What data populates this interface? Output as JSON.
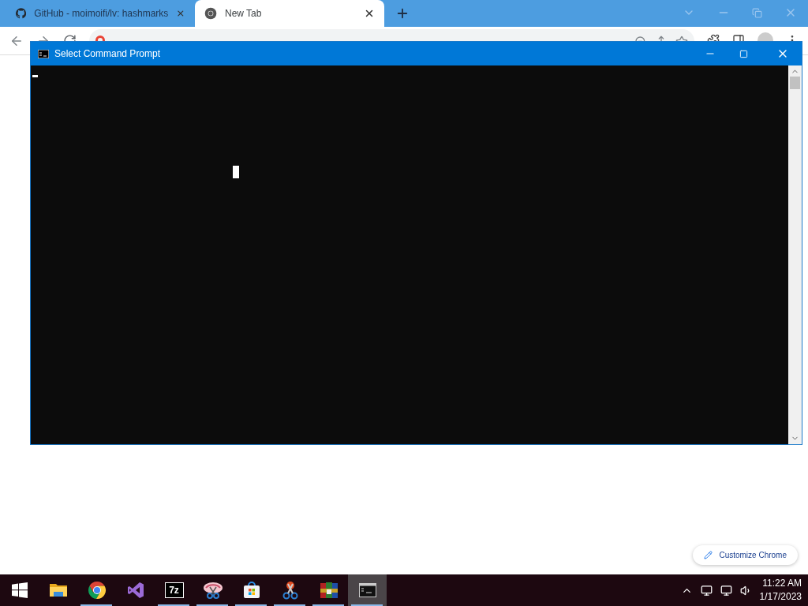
{
  "browser": {
    "tabs": [
      {
        "title": "GitHub - moimoifi/lv: hashmarks",
        "selected": false
      },
      {
        "title": "New Tab",
        "selected": true
      }
    ],
    "customize_button": "Customize Chrome"
  },
  "console_window": {
    "title": "Select Command Prompt"
  },
  "taskbar": {
    "apps": [
      {
        "kind": "start",
        "running": false,
        "selected": false
      },
      {
        "kind": "explorer",
        "running": false,
        "selected": false
      },
      {
        "kind": "chrome",
        "running": true,
        "selected": false
      },
      {
        "kind": "studio",
        "running": false,
        "selected": false
      },
      {
        "kind": "archive",
        "label": "7z",
        "running": true,
        "selected": false
      },
      {
        "kind": "snipping",
        "running": true,
        "selected": false
      },
      {
        "kind": "store",
        "running": true,
        "selected": false
      },
      {
        "kind": "scissors",
        "running": true,
        "selected": false
      },
      {
        "kind": "winrar",
        "running": true,
        "selected": false
      },
      {
        "kind": "console",
        "running": true,
        "selected": true
      }
    ],
    "clock": {
      "time": "11:22 AM",
      "date": "1/17/2023"
    }
  }
}
